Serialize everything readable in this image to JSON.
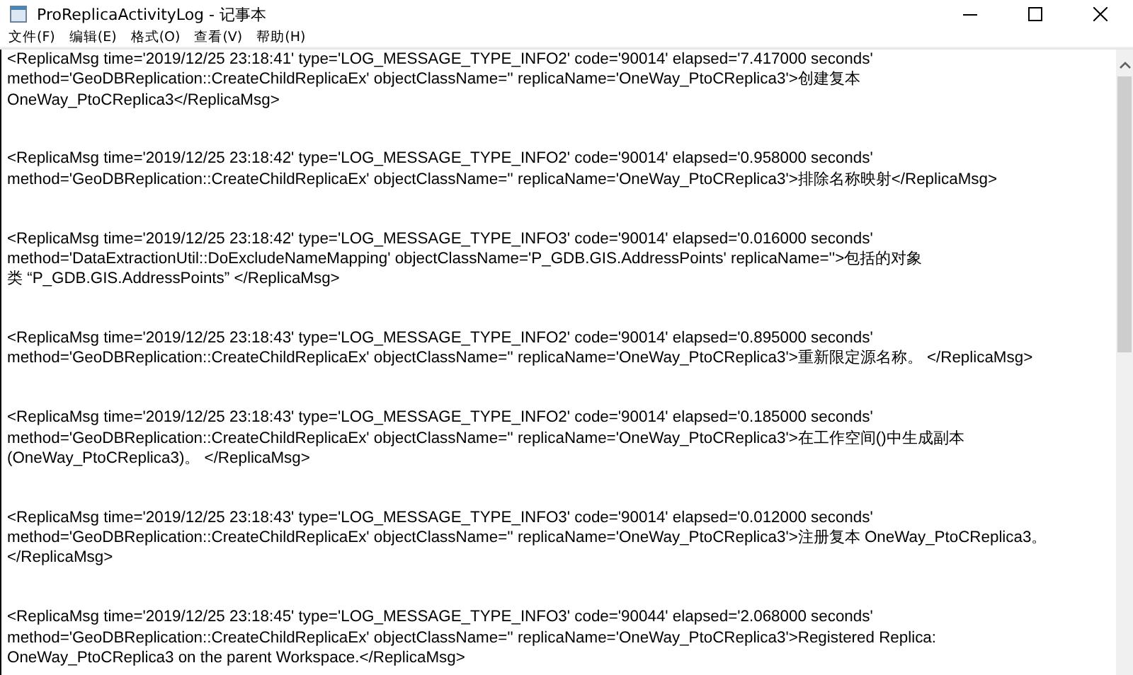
{
  "window": {
    "title": "ProReplicaActivityLog - 记事本"
  },
  "menu": [
    "文件(F)",
    "编辑(E)",
    "格式(O)",
    "查看(V)",
    "帮助(H)"
  ],
  "entries": [
    {
      "lines": [
        "<ReplicaMsg time='2019/12/25 23:18:41' type='LOG_MESSAGE_TYPE_INFO2' code='90014' elapsed='7.417000 seconds'",
        "method='GeoDBReplication::CreateChildReplicaEx' objectClassName='' replicaName='OneWay_PtoCReplica3'>创建复本",
        "OneWay_PtoCReplica3</ReplicaMsg>"
      ]
    },
    {
      "lines": [
        "<ReplicaMsg time='2019/12/25 23:18:42' type='LOG_MESSAGE_TYPE_INFO2' code='90014' elapsed='0.958000 seconds'",
        "method='GeoDBReplication::CreateChildReplicaEx' objectClassName='' replicaName='OneWay_PtoCReplica3'>排除名称映射</ReplicaMsg>"
      ]
    },
    {
      "lines": [
        "<ReplicaMsg time='2019/12/25 23:18:42' type='LOG_MESSAGE_TYPE_INFO3' code='90014' elapsed='0.016000 seconds'",
        "method='DataExtractionUtil::DoExcludeNameMapping' objectClassName='P_GDB.GIS.AddressPoints' replicaName=''>包括的对象",
        "类 “P_GDB.GIS.AddressPoints” </ReplicaMsg>"
      ]
    },
    {
      "lines": [
        "<ReplicaMsg time='2019/12/25 23:18:43' type='LOG_MESSAGE_TYPE_INFO2' code='90014' elapsed='0.895000 seconds'",
        "method='GeoDBReplication::CreateChildReplicaEx' objectClassName='' replicaName='OneWay_PtoCReplica3'>重新限定源名称。 </ReplicaMsg>"
      ]
    },
    {
      "lines": [
        "<ReplicaMsg time='2019/12/25 23:18:43' type='LOG_MESSAGE_TYPE_INFO2' code='90014' elapsed='0.185000 seconds'",
        "method='GeoDBReplication::CreateChildReplicaEx' objectClassName='' replicaName='OneWay_PtoCReplica3'>在工作空间()中生成副本",
        "(OneWay_PtoCReplica3)。 </ReplicaMsg>"
      ]
    },
    {
      "lines": [
        "<ReplicaMsg time='2019/12/25 23:18:43' type='LOG_MESSAGE_TYPE_INFO3' code='90014' elapsed='0.012000 seconds'",
        "method='GeoDBReplication::CreateChildReplicaEx' objectClassName='' replicaName='OneWay_PtoCReplica3'>注册复本 OneWay_PtoCReplica3。",
        "</ReplicaMsg>"
      ]
    },
    {
      "lines": [
        "<ReplicaMsg time='2019/12/25 23:18:45' type='LOG_MESSAGE_TYPE_INFO3' code='90044' elapsed='2.068000 seconds'",
        "method='GeoDBReplication::CreateChildReplicaEx' objectClassName='' replicaName='OneWay_PtoCReplica3'>Registered Replica:",
        "OneWay_PtoCReplica3 on the parent Workspace.</ReplicaMsg>"
      ]
    }
  ]
}
